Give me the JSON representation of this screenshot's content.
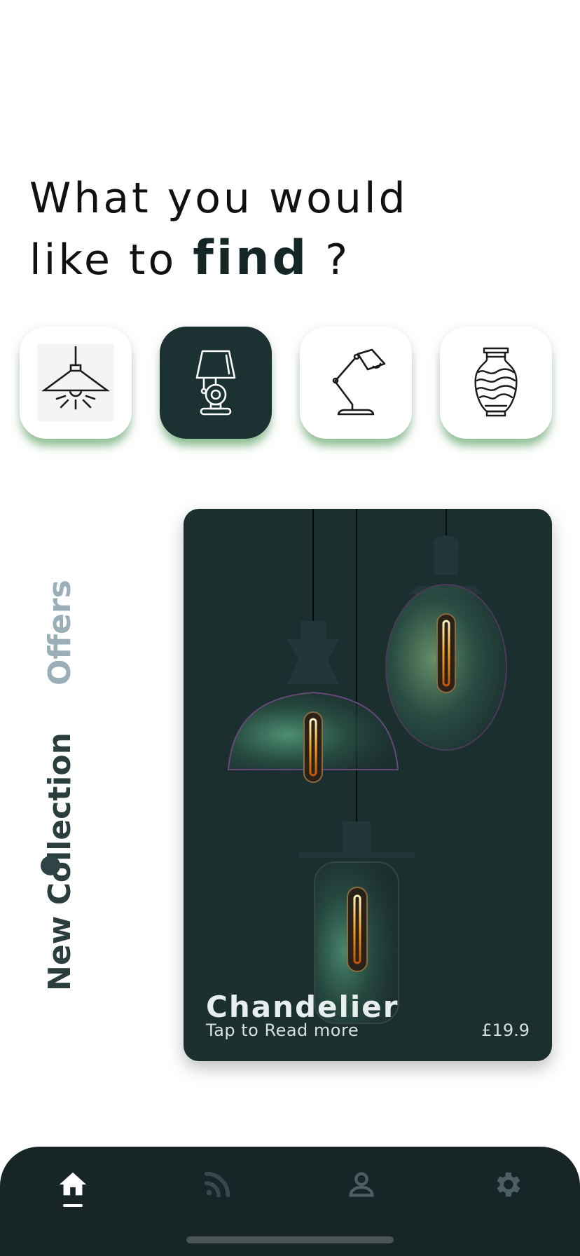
{
  "headline": {
    "line1": "What you would",
    "line2_prefix": "like to ",
    "line2_strong": "find",
    "line2_suffix": " ?"
  },
  "categories": [
    {
      "icon": "ceiling-lamp-icon",
      "active": false
    },
    {
      "icon": "table-lamp-icon",
      "active": true
    },
    {
      "icon": "desk-lamp-icon",
      "active": false
    },
    {
      "icon": "vase-icon",
      "active": false
    }
  ],
  "side_tabs": {
    "offers": "Offers",
    "new_collection": "New Collection",
    "active": "new_collection"
  },
  "product_card": {
    "title": "Chandelier",
    "subtitle": "Tap to Read more",
    "price": "£19.9"
  },
  "bottom_nav": [
    {
      "icon": "home-icon",
      "active": true
    },
    {
      "icon": "feed-icon",
      "active": false
    },
    {
      "icon": "profile-icon",
      "active": false
    },
    {
      "icon": "settings-icon",
      "active": false
    }
  ],
  "colors": {
    "accent_dark": "#1c3232",
    "nav_bg": "#172526",
    "shadow_green": "#3c9646",
    "offers_muted": "#9aaeb8"
  }
}
